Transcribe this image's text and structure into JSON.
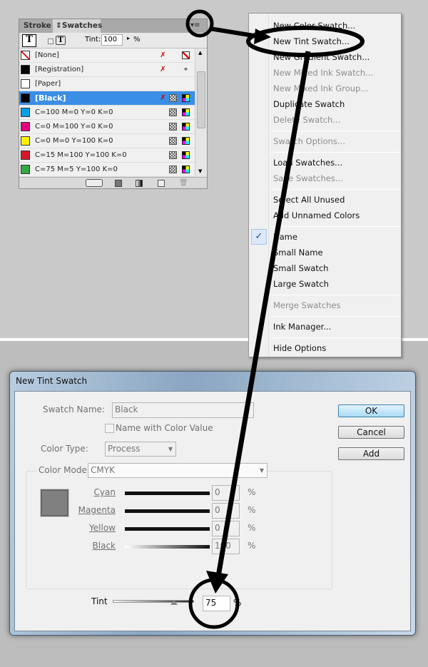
{
  "panel": {
    "tabs": [
      {
        "label": "Stroke"
      },
      {
        "label": "Swatches"
      }
    ],
    "tint_label": "Tint:",
    "tint_value": "100",
    "tint_unit": "%",
    "swatches": [
      {
        "name": "[None]",
        "color": "#ffffff"
      },
      {
        "name": "[Registration]",
        "color": "#000000"
      },
      {
        "name": "[Paper]",
        "color": "#ffffff"
      },
      {
        "name": "[Black]",
        "color": "#000000",
        "selected": true
      },
      {
        "name": "C=100 M=0 Y=0 K=0",
        "color": "#00a0e9"
      },
      {
        "name": "C=0 M=100 Y=0 K=0",
        "color": "#e4007f"
      },
      {
        "name": "C=0 M=0 Y=100 K=0",
        "color": "#fff100"
      },
      {
        "name": "C=15 M=100 Y=100 K=0",
        "color": "#d7182a"
      },
      {
        "name": "C=75 M=5 Y=100 K=0",
        "color": "#34a845"
      }
    ]
  },
  "menu": {
    "items": [
      {
        "label": "New Color Swatch...",
        "enabled": true
      },
      {
        "label": "New Tint Swatch...",
        "enabled": true
      },
      {
        "label": "New Gradient Swatch...",
        "enabled": true
      },
      {
        "label": "New Mixed Ink Swatch...",
        "enabled": false
      },
      {
        "label": "New Mixed Ink Group...",
        "enabled": false
      },
      {
        "label": "Duplicate Swatch",
        "enabled": true
      },
      {
        "label": "Delete Swatch...",
        "enabled": false
      },
      {
        "label": "Swatch Options...",
        "enabled": false
      },
      {
        "label": "Load Swatches...",
        "enabled": true
      },
      {
        "label": "Save Swatches...",
        "enabled": false
      },
      {
        "label": "Select All Unused",
        "enabled": true
      },
      {
        "label": "Add Unnamed Colors",
        "enabled": true
      },
      {
        "label": "Name",
        "enabled": true,
        "checked": true
      },
      {
        "label": "Small Name",
        "enabled": true
      },
      {
        "label": "Small Swatch",
        "enabled": true
      },
      {
        "label": "Large Swatch",
        "enabled": true
      },
      {
        "label": "Merge Swatches",
        "enabled": false
      },
      {
        "label": "Ink Manager...",
        "enabled": true
      },
      {
        "label": "Hide Options",
        "enabled": true
      }
    ],
    "checkmark": "✓"
  },
  "dialog": {
    "title": "New Tint Swatch",
    "swatch_name_label": "Swatch Name:",
    "swatch_name_value": "Black",
    "name_with_color_value_label": "Name with Color Value",
    "color_type_label": "Color Type:",
    "color_type_value": "Process",
    "color_mode_label": "Color Mode:",
    "color_mode_value": "CMYK",
    "preview_color": "#808080",
    "channels": [
      {
        "label": "Cyan",
        "value": "0"
      },
      {
        "label": "Magenta",
        "value": "0"
      },
      {
        "label": "Yellow",
        "value": "0"
      },
      {
        "label": "Black",
        "value": "100"
      }
    ],
    "percent": "%",
    "tint_label": "Tint",
    "tint_value": "75",
    "tint_percent": 75,
    "ok_label": "OK",
    "cancel_label": "Cancel",
    "add_label": "Add"
  }
}
